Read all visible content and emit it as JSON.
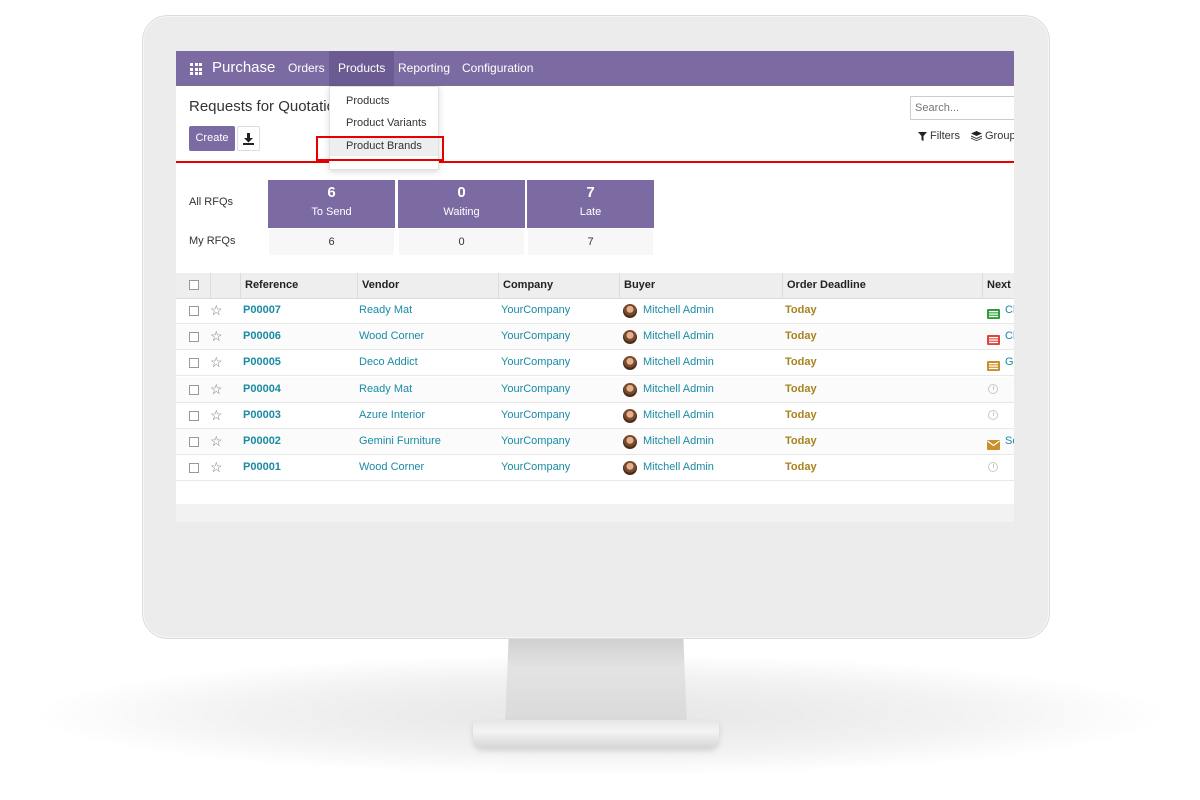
{
  "navbar": {
    "app_name": "Purchase",
    "menus": [
      "Orders",
      "Products",
      "Reporting",
      "Configuration"
    ],
    "active_menu": "Products"
  },
  "products_dropdown": {
    "items": [
      "Products",
      "Product Variants",
      "Product Brands"
    ],
    "highlighted": "Product Brands"
  },
  "control_panel": {
    "title": "Requests for Quotation",
    "create_label": "Create",
    "search_placeholder": "Search...",
    "filters_label": "Filters",
    "groupby_label": "Group"
  },
  "dashboard": {
    "row_labels": [
      "All RFQs",
      "My RFQs"
    ],
    "tiles": [
      {
        "value": "6",
        "label": "To Send",
        "my": "6"
      },
      {
        "value": "0",
        "label": "Waiting",
        "my": "0"
      },
      {
        "value": "7",
        "label": "Late",
        "my": "7"
      }
    ]
  },
  "table": {
    "columns": [
      "Reference",
      "Vendor",
      "Company",
      "Buyer",
      "Order Deadline",
      "Next A"
    ],
    "rows": [
      {
        "reference": "P00007",
        "vendor": "Ready Mat",
        "company": "YourCompany",
        "buyer": "Mitchell Admin",
        "deadline": "Today",
        "next_activity": "Cl",
        "activity_icon": "green-list"
      },
      {
        "reference": "P00006",
        "vendor": "Wood Corner",
        "company": "YourCompany",
        "buyer": "Mitchell Admin",
        "deadline": "Today",
        "next_activity": "Cl",
        "activity_icon": "red-list"
      },
      {
        "reference": "P00005",
        "vendor": "Deco Addict",
        "company": "YourCompany",
        "buyer": "Mitchell Admin",
        "deadline": "Today",
        "next_activity": "Ge",
        "activity_icon": "orange-list"
      },
      {
        "reference": "P00004",
        "vendor": "Ready Mat",
        "company": "YourCompany",
        "buyer": "Mitchell Admin",
        "deadline": "Today",
        "next_activity": "",
        "activity_icon": "clock"
      },
      {
        "reference": "P00003",
        "vendor": "Azure Interior",
        "company": "YourCompany",
        "buyer": "Mitchell Admin",
        "deadline": "Today",
        "next_activity": "",
        "activity_icon": "clock"
      },
      {
        "reference": "P00002",
        "vendor": "Gemini Furniture",
        "company": "YourCompany",
        "buyer": "Mitchell Admin",
        "deadline": "Today",
        "next_activity": "Se",
        "activity_icon": "envelope"
      },
      {
        "reference": "P00001",
        "vendor": "Wood Corner",
        "company": "YourCompany",
        "buyer": "Mitchell Admin",
        "deadline": "Today",
        "next_activity": "",
        "activity_icon": "clock"
      }
    ]
  },
  "colors": {
    "primary": "#7c6aa3",
    "link": "#1a8ba3",
    "deadline": "#a8821f",
    "highlight": "#e60000"
  }
}
